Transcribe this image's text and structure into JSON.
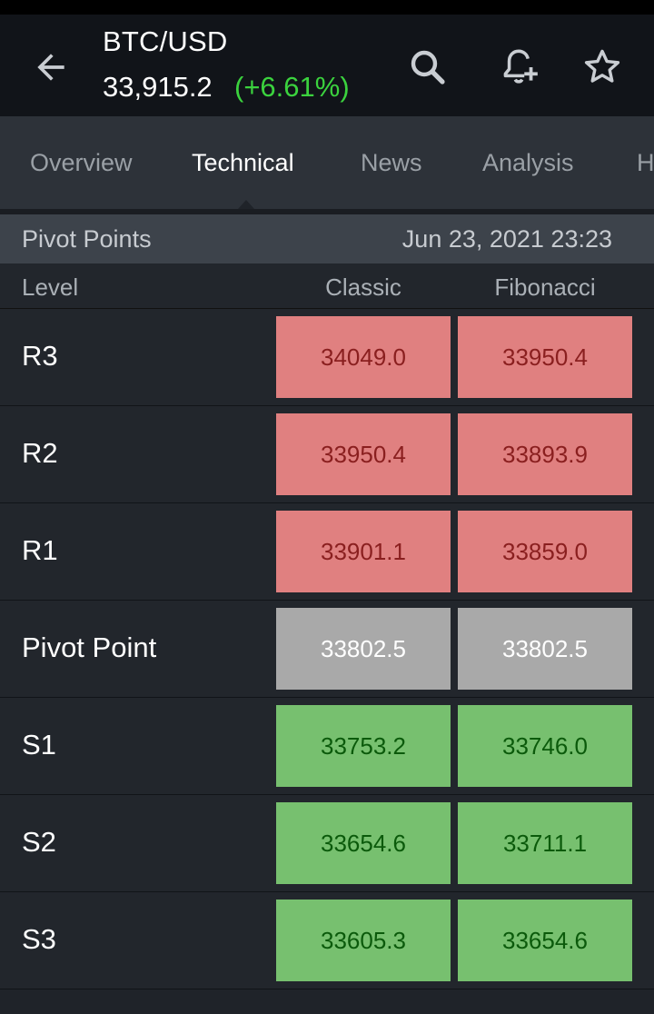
{
  "header": {
    "title": "BTC/USD",
    "price": "33,915.2",
    "change": "(+6.61%)",
    "icons": [
      "back-arrow-icon",
      "search-icon",
      "add-alert-bell-icon",
      "star-icon"
    ],
    "colors": {
      "background": "#111419",
      "change_positive": "#3bd23e"
    }
  },
  "tabs": {
    "items": [
      {
        "label": "Overview"
      },
      {
        "label": "Technical"
      },
      {
        "label": "News"
      },
      {
        "label": "Analysis"
      },
      {
        "label": "H"
      }
    ],
    "active": "Technical"
  },
  "pivot": {
    "section_title": "Pivot Points",
    "date": "Jun 23, 2021 23:23",
    "columns": {
      "level": "Level",
      "classic": "Classic",
      "fibonacci": "Fibonacci"
    },
    "rows": [
      {
        "level": "R3",
        "classic": "34049.0",
        "fibonacci": "33950.4",
        "tone": "red"
      },
      {
        "level": "R2",
        "classic": "33950.4",
        "fibonacci": "33893.9",
        "tone": "red"
      },
      {
        "level": "R1",
        "classic": "33901.1",
        "fibonacci": "33859.0",
        "tone": "red"
      },
      {
        "level": "Pivot Point",
        "classic": "33802.5",
        "fibonacci": "33802.5",
        "tone": "gray"
      },
      {
        "level": "S1",
        "classic": "33753.2",
        "fibonacci": "33746.0",
        "tone": "green"
      },
      {
        "level": "S2",
        "classic": "33654.6",
        "fibonacci": "33711.1",
        "tone": "green"
      },
      {
        "level": "S3",
        "classic": "33605.3",
        "fibonacci": "33654.6",
        "tone": "green"
      }
    ],
    "colors": {
      "resistance": "#e08080",
      "pivot": "#a9a9a9",
      "support": "#77c06f"
    }
  }
}
